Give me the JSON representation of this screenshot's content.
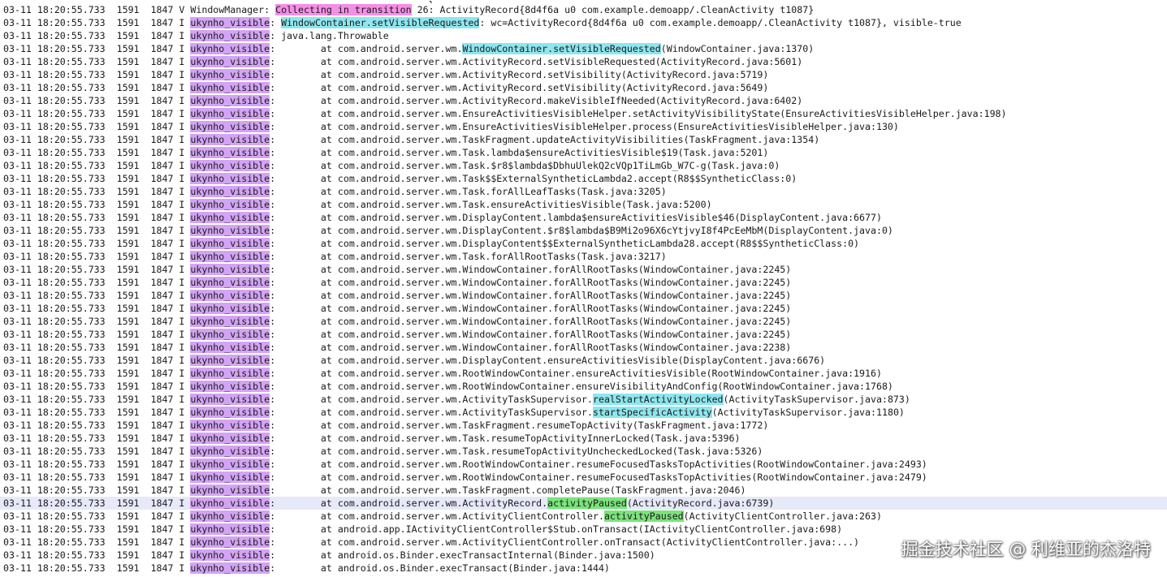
{
  "log": {
    "top_fragment": "                                                                       }, ...",
    "lines": [
      {
        "time": "03-11 18:20:55.733",
        "pid": "1591",
        "tid": "1847",
        "level": "V",
        "tag": "WindowManager",
        "tag_hl": false,
        "before": ": ",
        "hl": "Collecting in transition",
        "hl_color": "pink",
        "after": " 26: ActivityRecord{8d4f6a u0 com.example.demoapp/.CleanActivity t1087}"
      },
      {
        "time": "03-11 18:20:55.733",
        "pid": "1591",
        "tid": "1847",
        "level": "I",
        "tag": "ukynho_visible",
        "tag_hl": true,
        "before": ": ",
        "hl": "WindowContainer.setVisibleRequested",
        "hl_color": "cyan",
        "after": ": wc=ActivityRecord{8d4f6a u0 com.example.demoapp/.CleanActivity t1087}, visible-true"
      },
      {
        "time": "03-11 18:20:55.733",
        "pid": "1591",
        "tid": "1847",
        "level": "I",
        "tag": "ukynho_visible",
        "tag_hl": true,
        "before": ": java.lang.Throwable",
        "hl": "",
        "hl_color": "",
        "after": ""
      },
      {
        "time": "03-11 18:20:55.733",
        "pid": "1591",
        "tid": "1847",
        "level": "I",
        "tag": "ukynho_visible",
        "tag_hl": true,
        "before": ":        at com.android.server.wm.",
        "hl": "WindowContainer.setVisibleRequested",
        "hl_color": "cyan",
        "after": "(WindowContainer.java:1370)"
      },
      {
        "time": "03-11 18:20:55.733",
        "pid": "1591",
        "tid": "1847",
        "level": "I",
        "tag": "ukynho_visible",
        "tag_hl": true,
        "before": ":        at com.android.server.wm.ActivityRecord.setVisibleRequested(ActivityRecord.java:5601)",
        "hl": "",
        "hl_color": "",
        "after": ""
      },
      {
        "time": "03-11 18:20:55.733",
        "pid": "1591",
        "tid": "1847",
        "level": "I",
        "tag": "ukynho_visible",
        "tag_hl": true,
        "before": ":        at com.android.server.wm.ActivityRecord.setVisibility(ActivityRecord.java:5719)",
        "hl": "",
        "hl_color": "",
        "after": ""
      },
      {
        "time": "03-11 18:20:55.733",
        "pid": "1591",
        "tid": "1847",
        "level": "I",
        "tag": "ukynho_visible",
        "tag_hl": true,
        "before": ":        at com.android.server.wm.ActivityRecord.setVisibility(ActivityRecord.java:5649)",
        "hl": "",
        "hl_color": "",
        "after": ""
      },
      {
        "time": "03-11 18:20:55.733",
        "pid": "1591",
        "tid": "1847",
        "level": "I",
        "tag": "ukynho_visible",
        "tag_hl": true,
        "before": ":        at com.android.server.wm.ActivityRecord.makeVisibleIfNeeded(ActivityRecord.java:6402)",
        "hl": "",
        "hl_color": "",
        "after": ""
      },
      {
        "time": "03-11 18:20:55.733",
        "pid": "1591",
        "tid": "1847",
        "level": "I",
        "tag": "ukynho_visible",
        "tag_hl": true,
        "before": ":        at com.android.server.wm.EnsureActivitiesVisibleHelper.setActivityVisibilityState(EnsureActivitiesVisibleHelper.java:198)",
        "hl": "",
        "hl_color": "",
        "after": ""
      },
      {
        "time": "03-11 18:20:55.733",
        "pid": "1591",
        "tid": "1847",
        "level": "I",
        "tag": "ukynho_visible",
        "tag_hl": true,
        "before": ":        at com.android.server.wm.EnsureActivitiesVisibleHelper.process(EnsureActivitiesVisibleHelper.java:130)",
        "hl": "",
        "hl_color": "",
        "after": ""
      },
      {
        "time": "03-11 18:20:55.733",
        "pid": "1591",
        "tid": "1847",
        "level": "I",
        "tag": "ukynho_visible",
        "tag_hl": true,
        "before": ":        at com.android.server.wm.TaskFragment.updateActivityVisibilities(TaskFragment.java:1354)",
        "hl": "",
        "hl_color": "",
        "after": ""
      },
      {
        "time": "03-11 18:20:55.733",
        "pid": "1591",
        "tid": "1847",
        "level": "I",
        "tag": "ukynho_visible",
        "tag_hl": true,
        "before": ":        at com.android.server.wm.Task.lambda$ensureActivitiesVisible$19(Task.java:5201)",
        "hl": "",
        "hl_color": "",
        "after": ""
      },
      {
        "time": "03-11 18:20:55.733",
        "pid": "1591",
        "tid": "1847",
        "level": "I",
        "tag": "ukynho_visible",
        "tag_hl": true,
        "before": ":        at com.android.server.wm.Task.$r8$lambda$DbhuUlekQ2cVQp1TiLmGb_W7C-g(Task.java:0)",
        "hl": "",
        "hl_color": "",
        "after": ""
      },
      {
        "time": "03-11 18:20:55.733",
        "pid": "1591",
        "tid": "1847",
        "level": "I",
        "tag": "ukynho_visible",
        "tag_hl": true,
        "before": ":        at com.android.server.wm.Task$$ExternalSyntheticLambda2.accept(R8$$SyntheticClass:0)",
        "hl": "",
        "hl_color": "",
        "after": ""
      },
      {
        "time": "03-11 18:20:55.733",
        "pid": "1591",
        "tid": "1847",
        "level": "I",
        "tag": "ukynho_visible",
        "tag_hl": true,
        "before": ":        at com.android.server.wm.Task.forAllLeafTasks(Task.java:3205)",
        "hl": "",
        "hl_color": "",
        "after": ""
      },
      {
        "time": "03-11 18:20:55.733",
        "pid": "1591",
        "tid": "1847",
        "level": "I",
        "tag": "ukynho_visible",
        "tag_hl": true,
        "before": ":        at com.android.server.wm.Task.ensureActivitiesVisible(Task.java:5200)",
        "hl": "",
        "hl_color": "",
        "after": ""
      },
      {
        "time": "03-11 18:20:55.733",
        "pid": "1591",
        "tid": "1847",
        "level": "I",
        "tag": "ukynho_visible",
        "tag_hl": true,
        "before": ":        at com.android.server.wm.DisplayContent.lambda$ensureActivitiesVisible$46(DisplayContent.java:6677)",
        "hl": "",
        "hl_color": "",
        "after": ""
      },
      {
        "time": "03-11 18:20:55.733",
        "pid": "1591",
        "tid": "1847",
        "level": "I",
        "tag": "ukynho_visible",
        "tag_hl": true,
        "before": ":        at com.android.server.wm.DisplayContent.$r8$lambda$B9Mi2o96X6cYtjvyI8f4PcEeMbM(DisplayContent.java:0)",
        "hl": "",
        "hl_color": "",
        "after": ""
      },
      {
        "time": "03-11 18:20:55.733",
        "pid": "1591",
        "tid": "1847",
        "level": "I",
        "tag": "ukynho_visible",
        "tag_hl": true,
        "before": ":        at com.android.server.wm.DisplayContent$$ExternalSyntheticLambda28.accept(R8$$SyntheticClass:0)",
        "hl": "",
        "hl_color": "",
        "after": ""
      },
      {
        "time": "03-11 18:20:55.733",
        "pid": "1591",
        "tid": "1847",
        "level": "I",
        "tag": "ukynho_visible",
        "tag_hl": true,
        "before": ":        at com.android.server.wm.Task.forAllRootTasks(Task.java:3217)",
        "hl": "",
        "hl_color": "",
        "after": ""
      },
      {
        "time": "03-11 18:20:55.733",
        "pid": "1591",
        "tid": "1847",
        "level": "I",
        "tag": "ukynho_visible",
        "tag_hl": true,
        "before": ":        at com.android.server.wm.WindowContainer.forAllRootTasks(WindowContainer.java:2245)",
        "hl": "",
        "hl_color": "",
        "after": ""
      },
      {
        "time": "03-11 18:20:55.733",
        "pid": "1591",
        "tid": "1847",
        "level": "I",
        "tag": "ukynho_visible",
        "tag_hl": true,
        "before": ":        at com.android.server.wm.WindowContainer.forAllRootTasks(WindowContainer.java:2245)",
        "hl": "",
        "hl_color": "",
        "after": ""
      },
      {
        "time": "03-11 18:20:55.733",
        "pid": "1591",
        "tid": "1847",
        "level": "I",
        "tag": "ukynho_visible",
        "tag_hl": true,
        "before": ":        at com.android.server.wm.WindowContainer.forAllRootTasks(WindowContainer.java:2245)",
        "hl": "",
        "hl_color": "",
        "after": ""
      },
      {
        "time": "03-11 18:20:55.733",
        "pid": "1591",
        "tid": "1847",
        "level": "I",
        "tag": "ukynho_visible",
        "tag_hl": true,
        "before": ":        at com.android.server.wm.WindowContainer.forAllRootTasks(WindowContainer.java:2245)",
        "hl": "",
        "hl_color": "",
        "after": ""
      },
      {
        "time": "03-11 18:20:55.733",
        "pid": "1591",
        "tid": "1847",
        "level": "I",
        "tag": "ukynho_visible",
        "tag_hl": true,
        "before": ":        at com.android.server.wm.WindowContainer.forAllRootTasks(WindowContainer.java:2245)",
        "hl": "",
        "hl_color": "",
        "after": ""
      },
      {
        "time": "03-11 18:20:55.733",
        "pid": "1591",
        "tid": "1847",
        "level": "I",
        "tag": "ukynho_visible",
        "tag_hl": true,
        "before": ":        at com.android.server.wm.WindowContainer.forAllRootTasks(WindowContainer.java:2245)",
        "hl": "",
        "hl_color": "",
        "after": ""
      },
      {
        "time": "03-11 18:20:55.733",
        "pid": "1591",
        "tid": "1847",
        "level": "I",
        "tag": "ukynho_visible",
        "tag_hl": true,
        "before": ":        at com.android.server.wm.WindowContainer.forAllRootTasks(WindowContainer.java:2238)",
        "hl": "",
        "hl_color": "",
        "after": ""
      },
      {
        "time": "03-11 18:20:55.733",
        "pid": "1591",
        "tid": "1847",
        "level": "I",
        "tag": "ukynho_visible",
        "tag_hl": true,
        "before": ":        at com.android.server.wm.DisplayContent.ensureActivitiesVisible(DisplayContent.java:6676)",
        "hl": "",
        "hl_color": "",
        "after": ""
      },
      {
        "time": "03-11 18:20:55.733",
        "pid": "1591",
        "tid": "1847",
        "level": "I",
        "tag": "ukynho_visible",
        "tag_hl": true,
        "before": ":        at com.android.server.wm.RootWindowContainer.ensureActivitiesVisible(RootWindowContainer.java:1916)",
        "hl": "",
        "hl_color": "",
        "after": ""
      },
      {
        "time": "03-11 18:20:55.733",
        "pid": "1591",
        "tid": "1847",
        "level": "I",
        "tag": "ukynho_visible",
        "tag_hl": true,
        "before": ":        at com.android.server.wm.RootWindowContainer.ensureVisibilityAndConfig(RootWindowContainer.java:1768)",
        "hl": "",
        "hl_color": "",
        "after": ""
      },
      {
        "time": "03-11 18:20:55.733",
        "pid": "1591",
        "tid": "1847",
        "level": "I",
        "tag": "ukynho_visible",
        "tag_hl": true,
        "before": ":        at com.android.server.wm.ActivityTaskSupervisor.",
        "hl": "realStartActivityLocked",
        "hl_color": "cyan",
        "after": "(ActivityTaskSupervisor.java:873)"
      },
      {
        "time": "03-11 18:20:55.733",
        "pid": "1591",
        "tid": "1847",
        "level": "I",
        "tag": "ukynho_visible",
        "tag_hl": true,
        "before": ":        at com.android.server.wm.ActivityTaskSupervisor.",
        "hl": "startSpecificActivity",
        "hl_color": "cyan",
        "after": "(ActivityTaskSupervisor.java:1180)"
      },
      {
        "time": "03-11 18:20:55.733",
        "pid": "1591",
        "tid": "1847",
        "level": "I",
        "tag": "ukynho_visible",
        "tag_hl": true,
        "before": ":        at com.android.server.wm.TaskFragment.resumeTopActivity(TaskFragment.java:1772)",
        "hl": "",
        "hl_color": "",
        "after": ""
      },
      {
        "time": "03-11 18:20:55.733",
        "pid": "1591",
        "tid": "1847",
        "level": "I",
        "tag": "ukynho_visible",
        "tag_hl": true,
        "before": ":        at com.android.server.wm.Task.resumeTopActivityInnerLocked(Task.java:5396)",
        "hl": "",
        "hl_color": "",
        "after": ""
      },
      {
        "time": "03-11 18:20:55.733",
        "pid": "1591",
        "tid": "1847",
        "level": "I",
        "tag": "ukynho_visible",
        "tag_hl": true,
        "before": ":        at com.android.server.wm.Task.resumeTopActivityUncheckedLocked(Task.java:5326)",
        "hl": "",
        "hl_color": "",
        "after": ""
      },
      {
        "time": "03-11 18:20:55.733",
        "pid": "1591",
        "tid": "1847",
        "level": "I",
        "tag": "ukynho_visible",
        "tag_hl": true,
        "before": ":        at com.android.server.wm.RootWindowContainer.resumeFocusedTasksTopActivities(RootWindowContainer.java:2493)",
        "hl": "",
        "hl_color": "",
        "after": ""
      },
      {
        "time": "03-11 18:20:55.733",
        "pid": "1591",
        "tid": "1847",
        "level": "I",
        "tag": "ukynho_visible",
        "tag_hl": true,
        "before": ":        at com.android.server.wm.RootWindowContainer.resumeFocusedTasksTopActivities(RootWindowContainer.java:2479)",
        "hl": "",
        "hl_color": "",
        "after": ""
      },
      {
        "time": "03-11 18:20:55.733",
        "pid": "1591",
        "tid": "1847",
        "level": "I",
        "tag": "ukynho_visible",
        "tag_hl": true,
        "before": ":        at com.android.server.wm.TaskFragment.completePause(TaskFragment.java:2046)",
        "hl": "",
        "hl_color": "",
        "after": ""
      },
      {
        "time": "03-11 18:20:55.733",
        "pid": "1591",
        "tid": "1847",
        "level": "I",
        "tag": "ukynho_visible",
        "tag_hl": true,
        "before": ":        at com.android.server.wm.ActivityRecord.",
        "hl": "activityPaused",
        "hl_color": "green",
        "after": "(ActivityRecord.java:6739)",
        "selected": true
      },
      {
        "time": "03-11 18:20:55.733",
        "pid": "1591",
        "tid": "1847",
        "level": "I",
        "tag": "ukynho_visible",
        "tag_hl": true,
        "before": ":        at com.android.server.wm.ActivityClientController.",
        "hl": "activityPaused",
        "hl_color": "green",
        "after": "(ActivityClientController.java:263)"
      },
      {
        "time": "03-11 18:20:55.733",
        "pid": "1591",
        "tid": "1847",
        "level": "I",
        "tag": "ukynho_visible",
        "tag_hl": true,
        "before": ":        at android.app.IActivityClientController$Stub.onTransact(IActivityClientController.java:698)",
        "hl": "",
        "hl_color": "",
        "after": ""
      },
      {
        "time": "03-11 18:20:55.733",
        "pid": "1591",
        "tid": "1847",
        "level": "I",
        "tag": "ukynho_visible",
        "tag_hl": true,
        "before": ":        at com.android.server.wm.ActivityClientController.onTransact(ActivityClientController.java:...)",
        "hl": "",
        "hl_color": "",
        "after": ""
      },
      {
        "time": "03-11 18:20:55.733",
        "pid": "1591",
        "tid": "1847",
        "level": "I",
        "tag": "ukynho_visible",
        "tag_hl": true,
        "before": ":        at android.os.Binder.execTransactInternal(Binder.java:1500)",
        "hl": "",
        "hl_color": "",
        "after": ""
      },
      {
        "time": "03-11 18:20:55.733",
        "pid": "1591",
        "tid": "1847",
        "level": "I",
        "tag": "ukynho_visible",
        "tag_hl": true,
        "before": ":        at android.os.Binder.execTransact(Binder.java:1444)",
        "hl": "",
        "hl_color": "",
        "after": ""
      }
    ]
  },
  "watermark": "掘金技术社区 @ 利维亚的杰洛特",
  "colors": {
    "tag_highlight": "#d3a4f3",
    "pink_highlight": "#f58ee6",
    "cyan_highlight": "#8ee6ef",
    "green_highlight": "#7be37b",
    "selected_line": "#e6e9f8"
  }
}
